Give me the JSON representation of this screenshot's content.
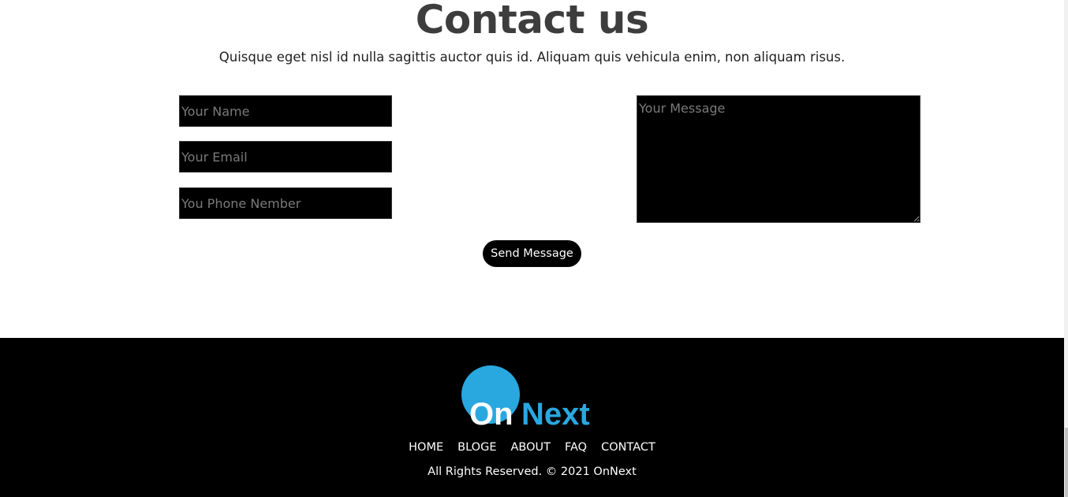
{
  "contact": {
    "title": "Contact us",
    "subtitle": "Quisque eget nisl id nulla sagittis auctor quis id. Aliquam quis vehicula enim, non aliquam risus."
  },
  "form": {
    "name_placeholder": "Your Name",
    "email_placeholder": "Your Email",
    "phone_placeholder": "You Phone Nember",
    "message_placeholder": "Your Message",
    "send_label": "Send Message"
  },
  "footer": {
    "logo": {
      "part1": "On",
      "part2": "Next"
    },
    "nav": [
      "HOME",
      "BLOGE",
      "ABOUT",
      "FAQ",
      "CONTACT"
    ],
    "copyright": "All Rights Reserved. © 2021 OnNext"
  },
  "colors": {
    "brand_blue": "#29a8e0",
    "footer_bg": "#000000",
    "field_bg": "#000000",
    "title_color": "#3d3d3d"
  }
}
